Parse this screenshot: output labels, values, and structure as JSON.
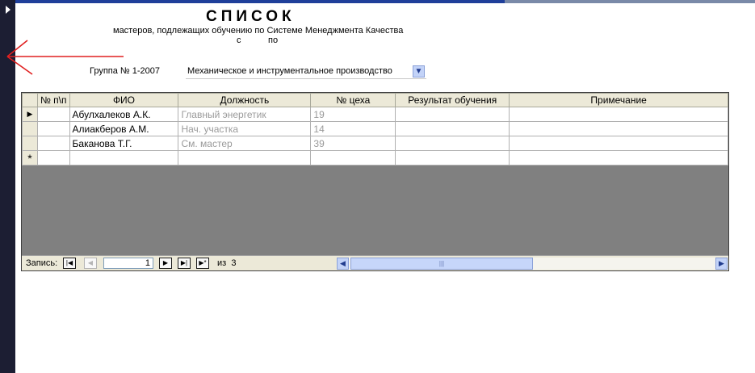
{
  "report": {
    "title": "СПИСОК",
    "subtitle": "мастеров, подлежащих обучению по Системе Менеджмента Качества",
    "from_label": "с",
    "to_label": "по"
  },
  "group": {
    "label": "Группа № 1-2007",
    "value": "Механическое и инструментальное производство"
  },
  "grid": {
    "columns": [
      "№ п\\п",
      "ФИО",
      "Должность",
      "№ цеха",
      "Результат обучения",
      "Примечание"
    ],
    "rows": [
      {
        "num": "",
        "fio": "Абулхалеков А.К.",
        "position": "Главный энергетик",
        "shop": "19",
        "result": "",
        "note": ""
      },
      {
        "num": "",
        "fio": "Алиакберов А.М.",
        "position": "Нач. участка",
        "shop": "14",
        "result": "",
        "note": ""
      },
      {
        "num": "",
        "fio": "Баканова Т.Г.",
        "position": "См. мастер",
        "shop": "39",
        "result": "",
        "note": ""
      }
    ],
    "new_row_marker": "*"
  },
  "navigation": {
    "record_label": "Запись:",
    "current": "1",
    "of_label": "из",
    "total": "3"
  },
  "colors": {
    "left_bar": "#1c1e33",
    "top_bar": "#1f3f9a",
    "annotation_arrow": "#e02020",
    "grid_empty": "#808080"
  }
}
